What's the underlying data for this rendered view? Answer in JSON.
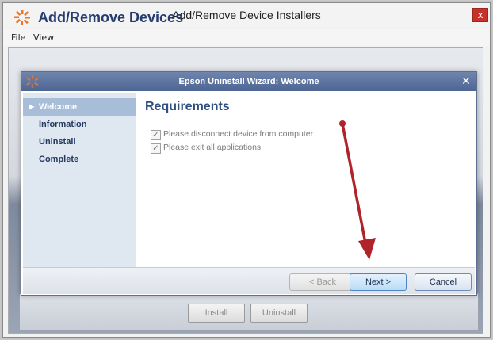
{
  "outer_window": {
    "title": "Add/Remove Device Installers",
    "close_glyph": "x",
    "menu": [
      "File",
      "View"
    ]
  },
  "app": {
    "title": "Add/Remove Devices",
    "logo_icon": "epson-spark-icon",
    "buttons": {
      "install": "Install",
      "uninstall": "Uninstall"
    }
  },
  "wizard": {
    "title": "Epson Uninstall Wizard: Welcome",
    "close_glyph": "✕",
    "steps": [
      "Welcome",
      "Information",
      "Uninstall",
      "Complete"
    ],
    "active_step": "Welcome",
    "heading": "Requirements",
    "checks": [
      {
        "label": "Please disconnect device from computer",
        "checked": true
      },
      {
        "label": "Please exit all applications",
        "checked": true
      }
    ],
    "buttons": {
      "back": "< Back",
      "next": "Next >",
      "cancel": "Cancel"
    }
  },
  "colors": {
    "accent_red": "#b0232a",
    "title_blue": "#243c6e",
    "logo_orange": "#e8762c"
  }
}
